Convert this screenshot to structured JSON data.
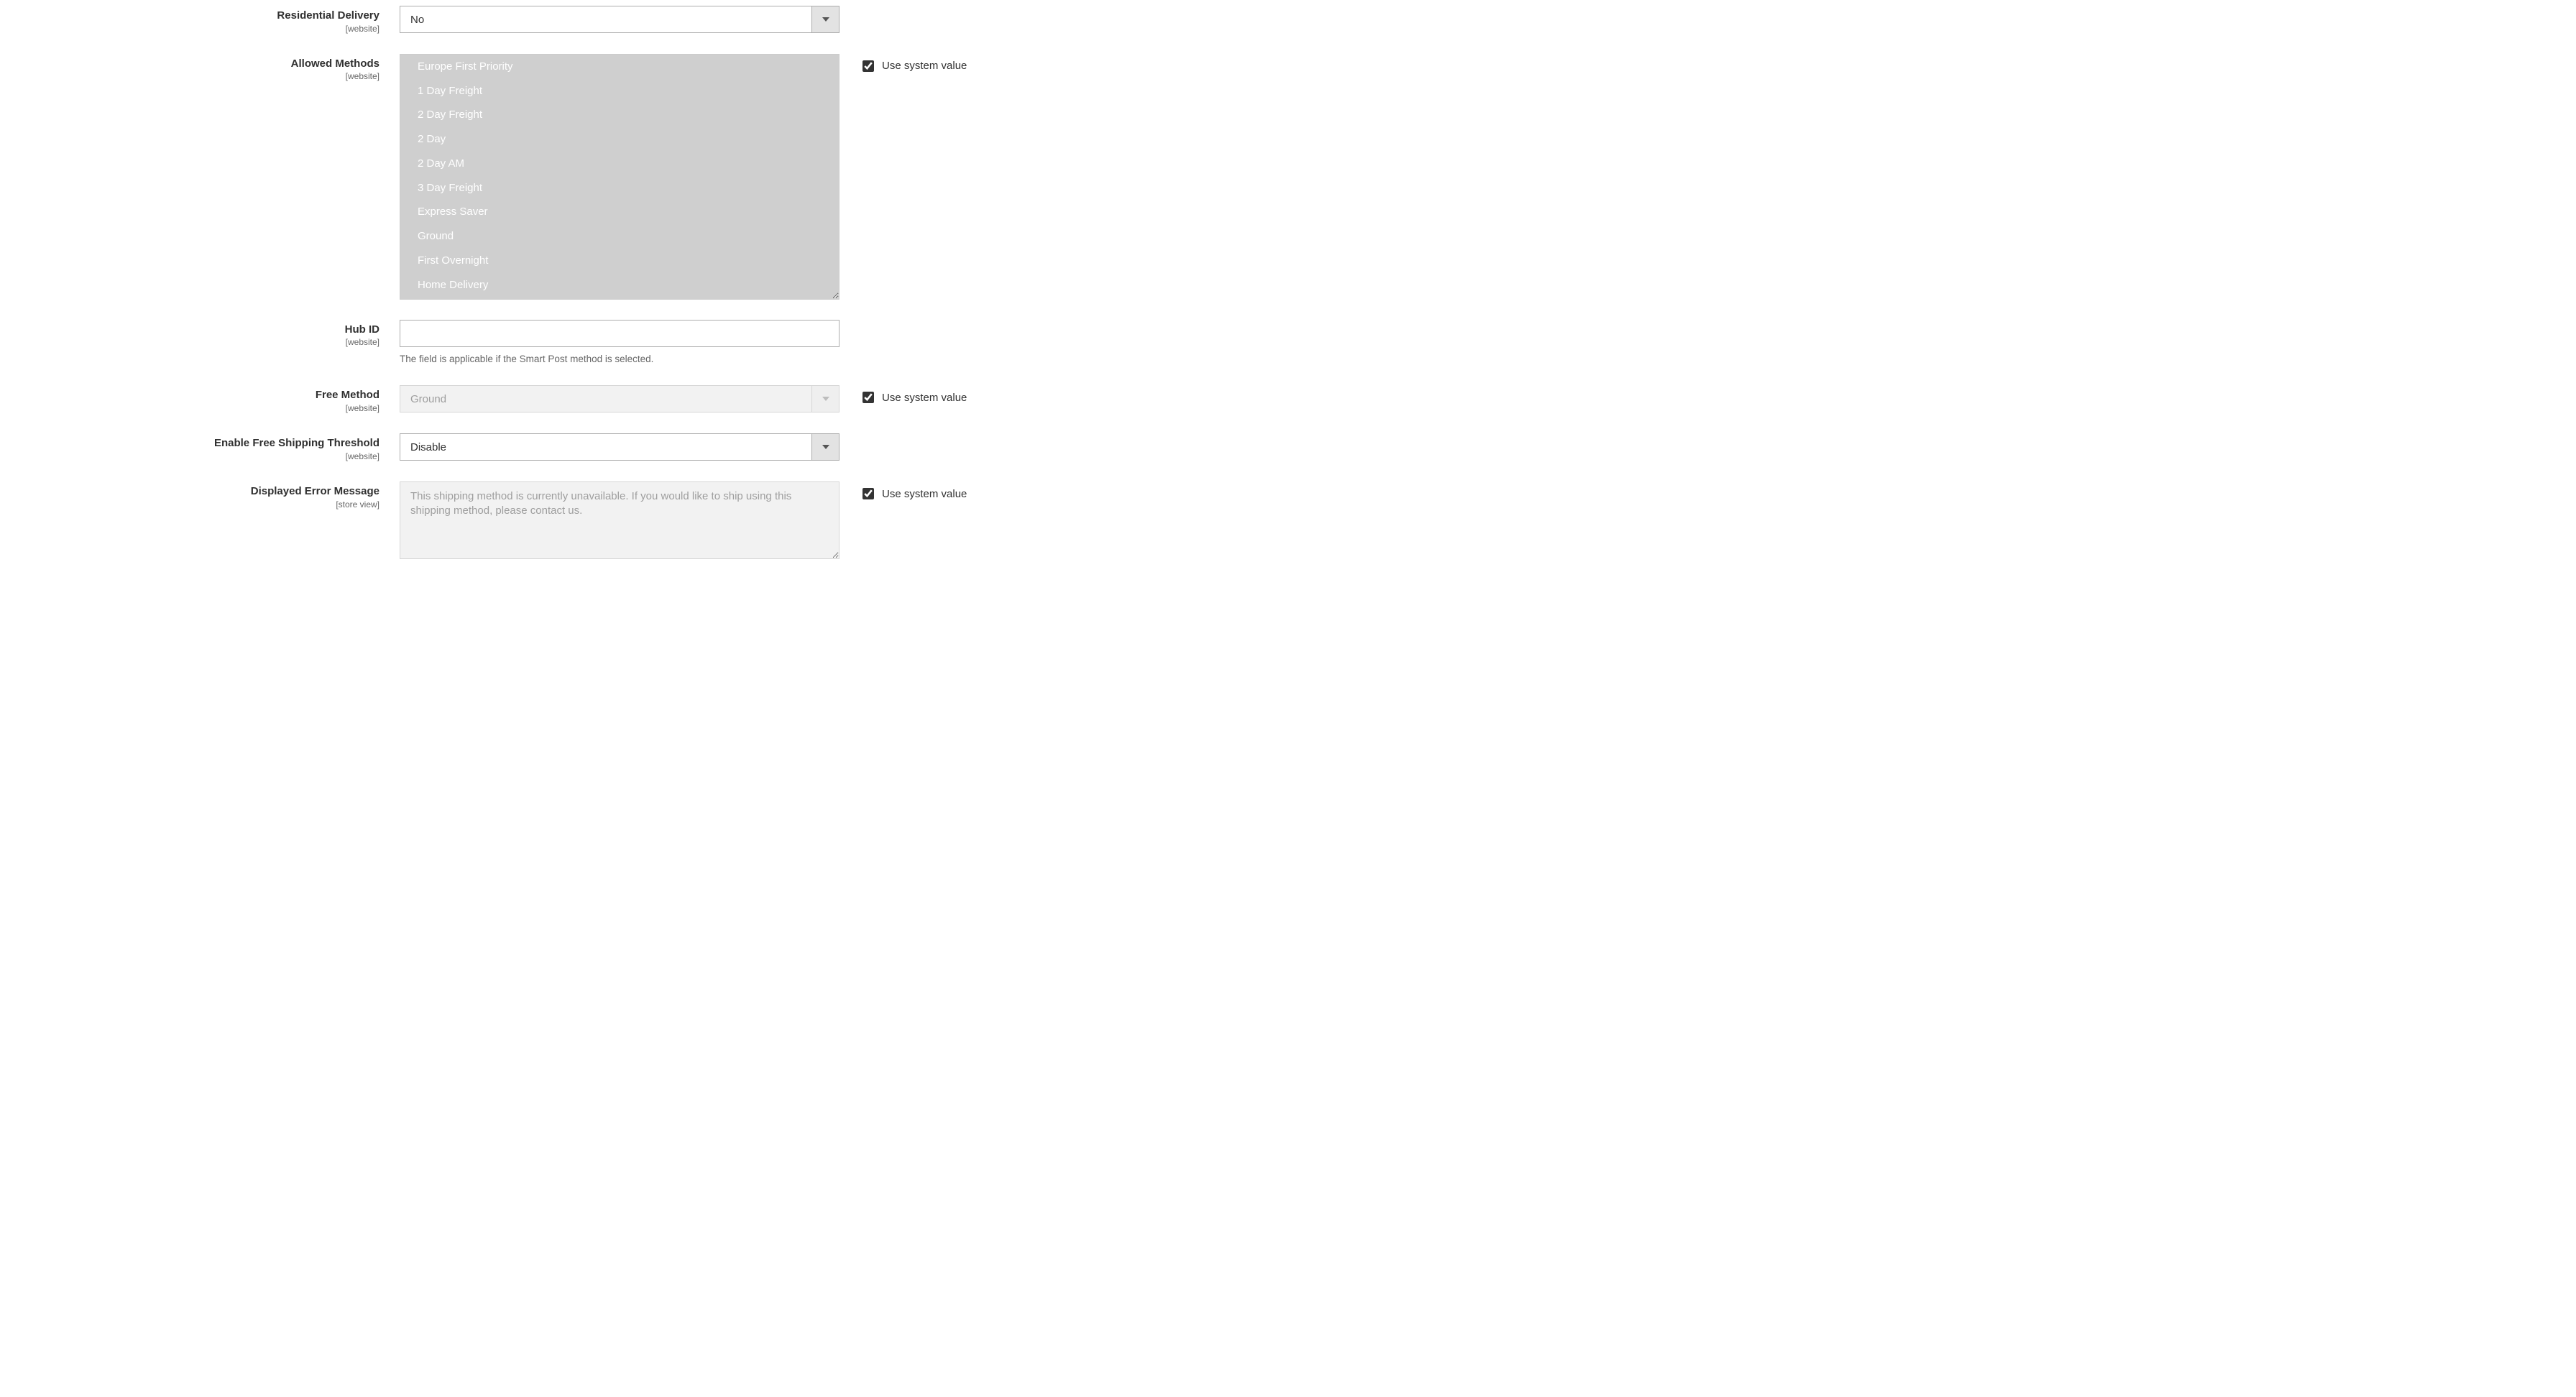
{
  "scope_website": "[website]",
  "scope_storeview": "[store view]",
  "use_system_value": "Use system value",
  "fields": {
    "residential_delivery": {
      "label": "Residential Delivery",
      "value": "No"
    },
    "allowed_methods": {
      "label": "Allowed Methods",
      "options": [
        "Europe First Priority",
        "1 Day Freight",
        "2 Day Freight",
        "2 Day",
        "2 Day AM",
        "3 Day Freight",
        "Express Saver",
        "Ground",
        "First Overnight",
        "Home Delivery"
      ],
      "use_system_checked": true
    },
    "hub_id": {
      "label": "Hub ID",
      "value": "",
      "note": "The field is applicable if the Smart Post method is selected."
    },
    "free_method": {
      "label": "Free Method",
      "value": "Ground",
      "use_system_checked": true
    },
    "enable_free_shipping_threshold": {
      "label": "Enable Free Shipping Threshold",
      "value": "Disable"
    },
    "displayed_error_message": {
      "label": "Displayed Error Message",
      "value": "This shipping method is currently unavailable. If you would like to ship using this shipping method, please contact us.",
      "use_system_checked": true
    }
  }
}
